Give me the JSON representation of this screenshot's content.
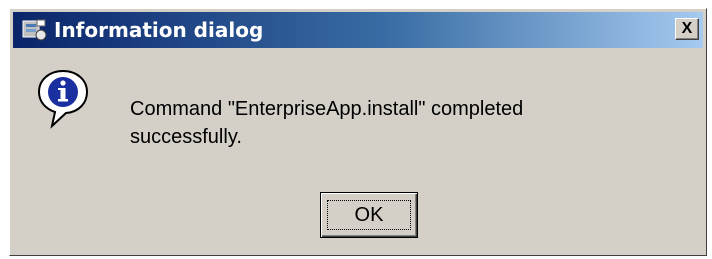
{
  "window": {
    "title": "Information dialog",
    "close_label": "X"
  },
  "dialog": {
    "message_line1": "Command \"EnterpriseApp.install\" completed",
    "message_line2": "successfully.",
    "ok_label": "OK"
  },
  "icons": {
    "app": "app-icon",
    "info": "info-icon"
  },
  "colors": {
    "titlebar_start": "#0a246a",
    "titlebar_end": "#a6caf0",
    "dialog_bg": "#d4d0c8",
    "info_blue": "#1a2fa0"
  }
}
